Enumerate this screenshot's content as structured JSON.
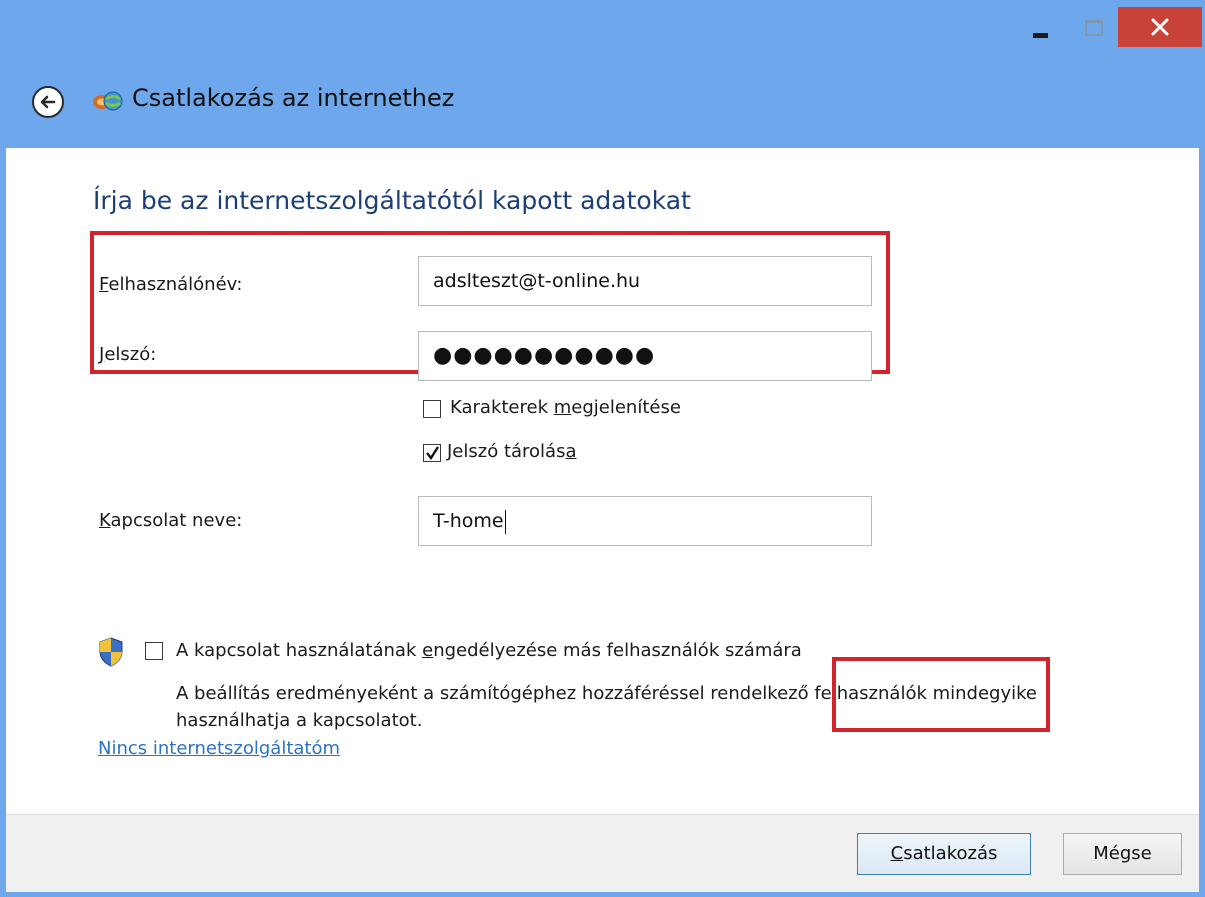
{
  "window": {
    "title": "Csatlakozás az internethez",
    "accent_color": "#6ea7ec",
    "close_color": "#c8423a",
    "highlight_color": "#d1242c"
  },
  "heading": "Írja be az internetszolgáltatótól kapott adatokat",
  "fields": {
    "username": {
      "label_first": "F",
      "label_rest": "elhasználónév:",
      "value": "adslteszt@t-online.hu"
    },
    "password": {
      "label_first": "J",
      "label_rest": "elszó:",
      "value": "●●●●●●●●●●●"
    },
    "connection_name": {
      "label_first": "K",
      "label_rest": "apcsolat neve:",
      "value": "T-home"
    }
  },
  "checkboxes": {
    "show_chars": {
      "label_pre": "Karakterek ",
      "label_u": "m",
      "label_post": "egjelenítése",
      "checked": false
    },
    "remember_password": {
      "label_pre": "Jelszó tárolás",
      "label_u": "a",
      "label_post": "",
      "checked": true
    },
    "allow_others": {
      "label_pre": "A kapcsolat használatának ",
      "label_u": "e",
      "label_post": "ngedélyezése más felhasználók számára",
      "checked": false
    }
  },
  "allow_description": "A beállítás eredményeként a számítógéphez hozzáféréssel rendelkező felhasználók mindegyike használhatja a kapcsolatot.",
  "no_isp_link": "Nincs internetszolgáltatóm",
  "buttons": {
    "connect_first": "C",
    "connect_rest": "satlakozás",
    "cancel": "Mégse"
  },
  "icons": [
    "minimize-icon",
    "maximize-icon",
    "close-icon",
    "back-arrow-icon",
    "network-connection-icon",
    "uac-shield-icon",
    "checkmark-icon"
  ]
}
